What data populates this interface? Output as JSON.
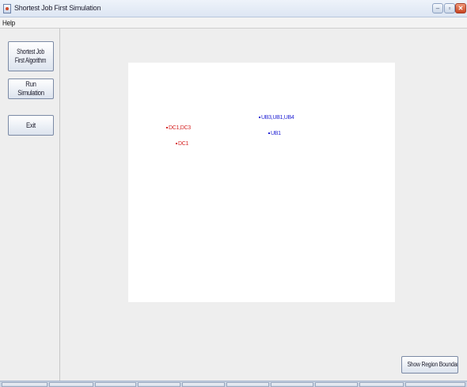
{
  "window": {
    "title": "Shortest Job First Simulation",
    "buttons": {
      "minimize": "–",
      "maximize": "▫",
      "close": "✕"
    }
  },
  "menubar": {
    "items": [
      "Help"
    ]
  },
  "sidebar": {
    "sjf_line1": "Shortest Job",
    "sjf_line2": "First Algorithm",
    "run_label": "Run Simulation",
    "exit_label": "Exit"
  },
  "canvas": {
    "markers": {
      "dc_top": "DC1,DC3",
      "dc_bottom": "DC1",
      "ub_top": "UB3,UB1,UB4",
      "ub_bottom": "UB1"
    },
    "colors": {
      "datacenter": "#d62828",
      "userbase": "#2424d4"
    }
  },
  "region_button": {
    "label": "Show Region Boundaries"
  },
  "icons": [
    "app-icon",
    "minimize-icon",
    "maximize-icon",
    "close-icon"
  ]
}
